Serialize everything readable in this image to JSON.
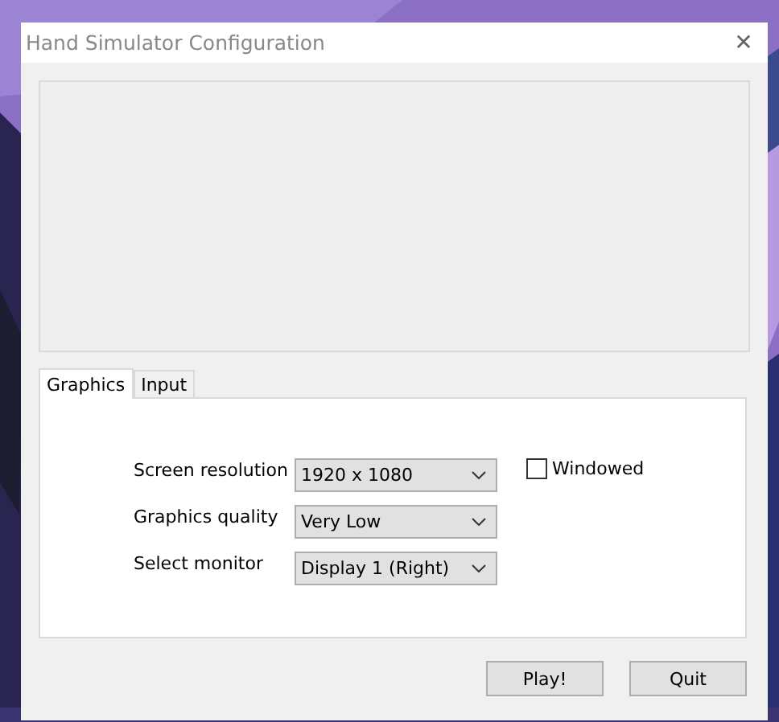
{
  "window": {
    "title": "Hand Simulator Configuration",
    "close": "✕"
  },
  "tabs": [
    {
      "label": "Graphics",
      "selected": true
    },
    {
      "label": "Input",
      "selected": false
    }
  ],
  "settings": [
    {
      "label": "Screen resolution",
      "value": "1920 x 1080"
    },
    {
      "label": "Graphics quality",
      "value": "Very Low"
    },
    {
      "label": "Select monitor",
      "value": "Display 1 (Right)"
    }
  ],
  "windowed": {
    "label": "Windowed",
    "checked": false
  },
  "buttons": [
    "Play!",
    "Quit"
  ]
}
